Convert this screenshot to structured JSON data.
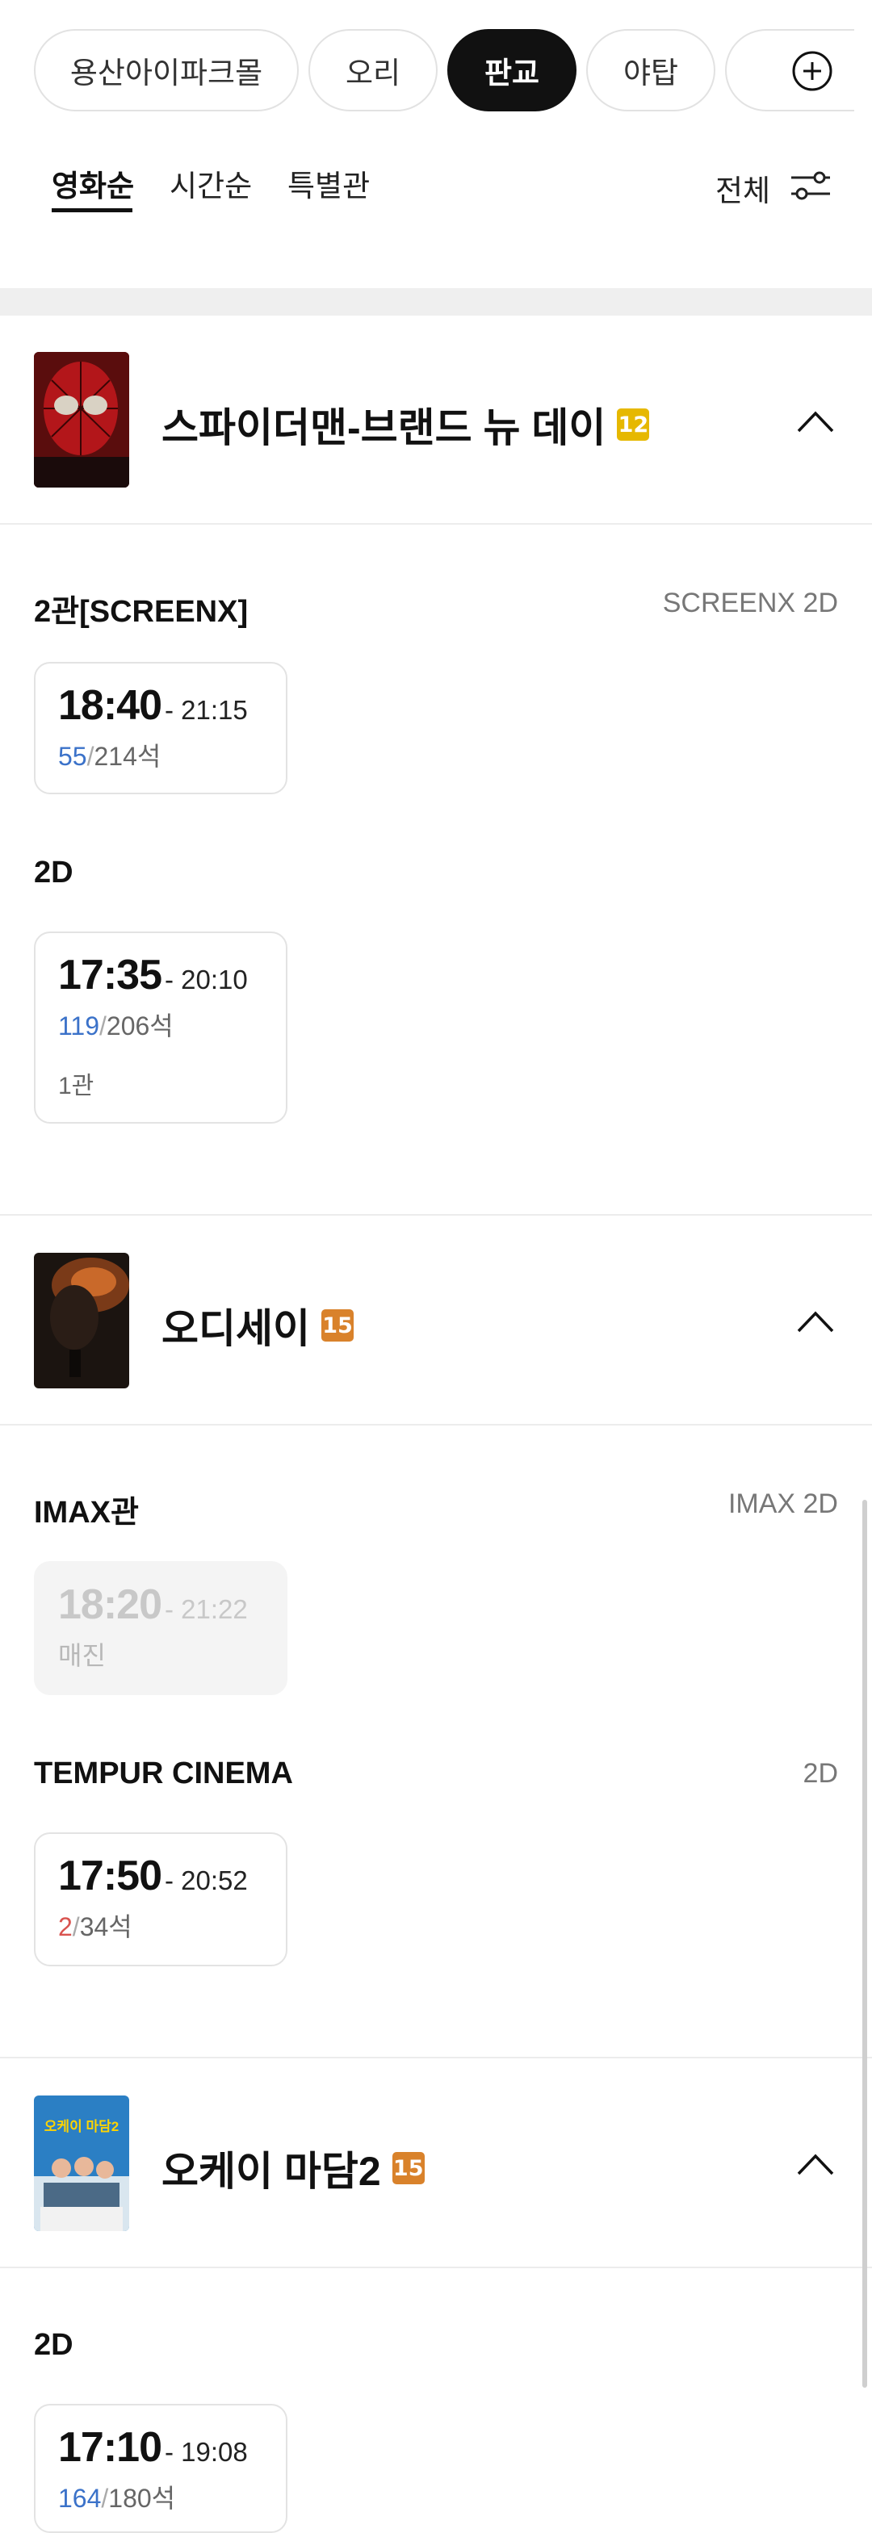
{
  "chips": [
    {
      "label": "용산아이파크몰",
      "active": false
    },
    {
      "label": "오리",
      "active": false
    },
    {
      "label": "판교",
      "active": true
    },
    {
      "label": "야탑",
      "active": false
    },
    {
      "label": "",
      "active": false
    }
  ],
  "sort_tabs": [
    {
      "label": "영화순",
      "active": true
    },
    {
      "label": "시간순",
      "active": false
    },
    {
      "label": "특별관",
      "active": false
    }
  ],
  "filter": {
    "all_label": "전체",
    "icon": "filter-sliders-icon"
  },
  "movies": [
    {
      "title": "스파이더맨-브랜드 뉴 데이",
      "rating": "12",
      "rating_color": "#e6b800",
      "screens": [
        {
          "name": "2관[SCREENX]",
          "type": "SCREENX 2D",
          "showtimes": [
            {
              "start": "18:40",
              "end": "- 21:15",
              "available": "55",
              "total": "214석"
            }
          ]
        },
        {
          "name": "2D",
          "type": "",
          "showtimes": [
            {
              "start": "17:35",
              "end": "- 20:10",
              "available": "119",
              "total": "206석",
              "hall": "1관"
            }
          ]
        }
      ]
    },
    {
      "title": "오디세이",
      "rating": "15",
      "rating_color": "#d9822b",
      "screens": [
        {
          "name": "IMAX관",
          "type": "IMAX 2D",
          "showtimes": [
            {
              "start": "18:20",
              "end": "- 21:22",
              "status": "매진"
            }
          ]
        },
        {
          "name": "TEMPUR CINEMA",
          "type": "2D",
          "showtimes": [
            {
              "start": "17:50",
              "end": "- 20:52",
              "available": "2",
              "total": "34석"
            }
          ]
        }
      ]
    },
    {
      "title": "오케이 마담2",
      "rating": "15",
      "rating_color": "#d9822b",
      "screens": [
        {
          "name": "2D",
          "type": "",
          "showtimes": [
            {
              "start": "17:10",
              "end": "- 19:08",
              "available": "164",
              "total": "180석"
            }
          ]
        }
      ]
    }
  ],
  "poster_text": {
    "okay_madam": "오케이 마담2"
  },
  "colors": {
    "available_seats": "#3b72c9",
    "low_seats": "#d9534f",
    "active_chip": "#111111"
  }
}
